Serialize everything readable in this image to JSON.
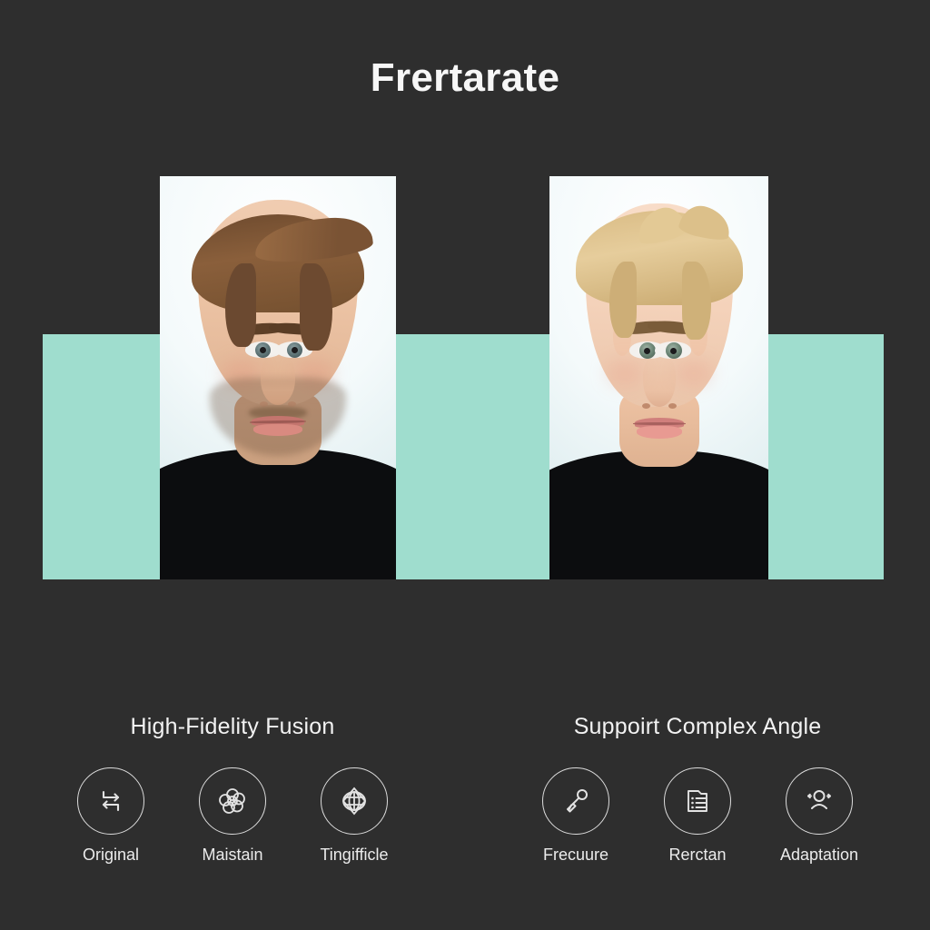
{
  "header": {
    "title": "Frertarate"
  },
  "comparison": {
    "band_color": "#9fddce",
    "background_color": "#2e2e2e",
    "panels": [
      {
        "name": "before-portrait",
        "caption": "",
        "hair_color": "#7a5334",
        "description": "Man with brown hair and light stubble, slight smile"
      },
      {
        "name": "after-portrait",
        "caption": "",
        "hair_color": "#dcc08a",
        "description": "Young man with blonde hair, clean shaven, neutral expression"
      }
    ]
  },
  "features": {
    "columns": [
      {
        "heading": "High-Fidelity Fusion",
        "items": [
          {
            "icon": "swap-arrows-icon",
            "label": "Original"
          },
          {
            "icon": "molecule-cluster-icon",
            "label": "Maistain"
          },
          {
            "icon": "globe-icon",
            "label": "Tingifficle"
          }
        ]
      },
      {
        "heading": "Suppoirt Complex Angle",
        "items": [
          {
            "icon": "pen-tool-icon",
            "label": "Frecuure"
          },
          {
            "icon": "document-list-icon",
            "label": "Rerctan"
          },
          {
            "icon": "user-adapt-icon",
            "label": "Adaptation"
          }
        ]
      }
    ]
  },
  "colors": {
    "background": "#2e2e2e",
    "accent_teal": "#9fddce",
    "text_primary": "#f2f2f2",
    "icon_stroke": "#dcdcdc"
  }
}
